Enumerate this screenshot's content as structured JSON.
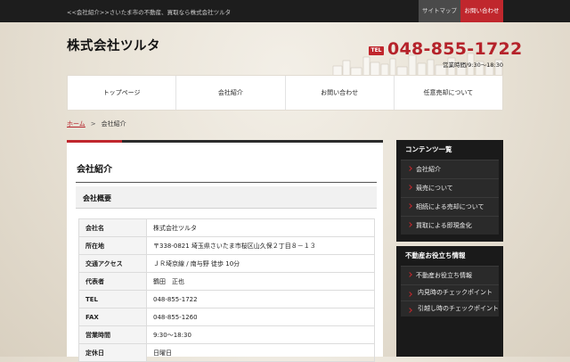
{
  "topbar": {
    "tagline": "<<会社紹介>>さいたま市の不動産、買取なら株式会社ツルタ",
    "sitemap": "サイトマップ",
    "contact": "お問い合わせ"
  },
  "header": {
    "logo": "株式会社ツルタ",
    "tel_badge": "TEL",
    "tel_number": "048-855-1722",
    "hours": "営業時間/9:30～18:30"
  },
  "nav": {
    "items": [
      {
        "label": "トップページ"
      },
      {
        "label": "会社紹介"
      },
      {
        "label": "お問い合わせ"
      },
      {
        "label": "任意売却について"
      }
    ]
  },
  "breadcrumb": {
    "home": "ホーム",
    "sep": ">",
    "current": "会社紹介"
  },
  "main": {
    "title": "会社紹介",
    "section_title": "会社概要",
    "rows": [
      {
        "label": "会社名",
        "value": "株式会社ツルタ"
      },
      {
        "label": "所在地",
        "value": "〒338-0821 埼玉県さいたま市桜区山久保２丁目８－１３"
      },
      {
        "label": "交通アクセス",
        "value": "ＪＲ埼京線 / 南与野 徒歩 10分"
      },
      {
        "label": "代表者",
        "value": "鶴田　正也"
      },
      {
        "label": "TEL",
        "value": "048-855-1722"
      },
      {
        "label": "FAX",
        "value": "048-855-1260"
      },
      {
        "label": "営業時間",
        "value": "9:30～18:30"
      },
      {
        "label": "定休日",
        "value": "日曜日"
      }
    ]
  },
  "sidebar": {
    "contents": {
      "title": "コンテンツ一覧",
      "items": [
        {
          "label": "会社紹介"
        },
        {
          "label": "競売について"
        },
        {
          "label": "相続による売却について"
        },
        {
          "label": "買取による即現金化"
        }
      ]
    },
    "tips": {
      "title": "不動産お役立ち情報",
      "items": [
        {
          "label": "不動産お役立ち情報"
        },
        {
          "label": "内見時のチェックポイント"
        },
        {
          "label": "引越し時のチェックポイント"
        }
      ]
    }
  },
  "colors": {
    "accent": "#c0272d",
    "dark": "#1a1a1a"
  }
}
